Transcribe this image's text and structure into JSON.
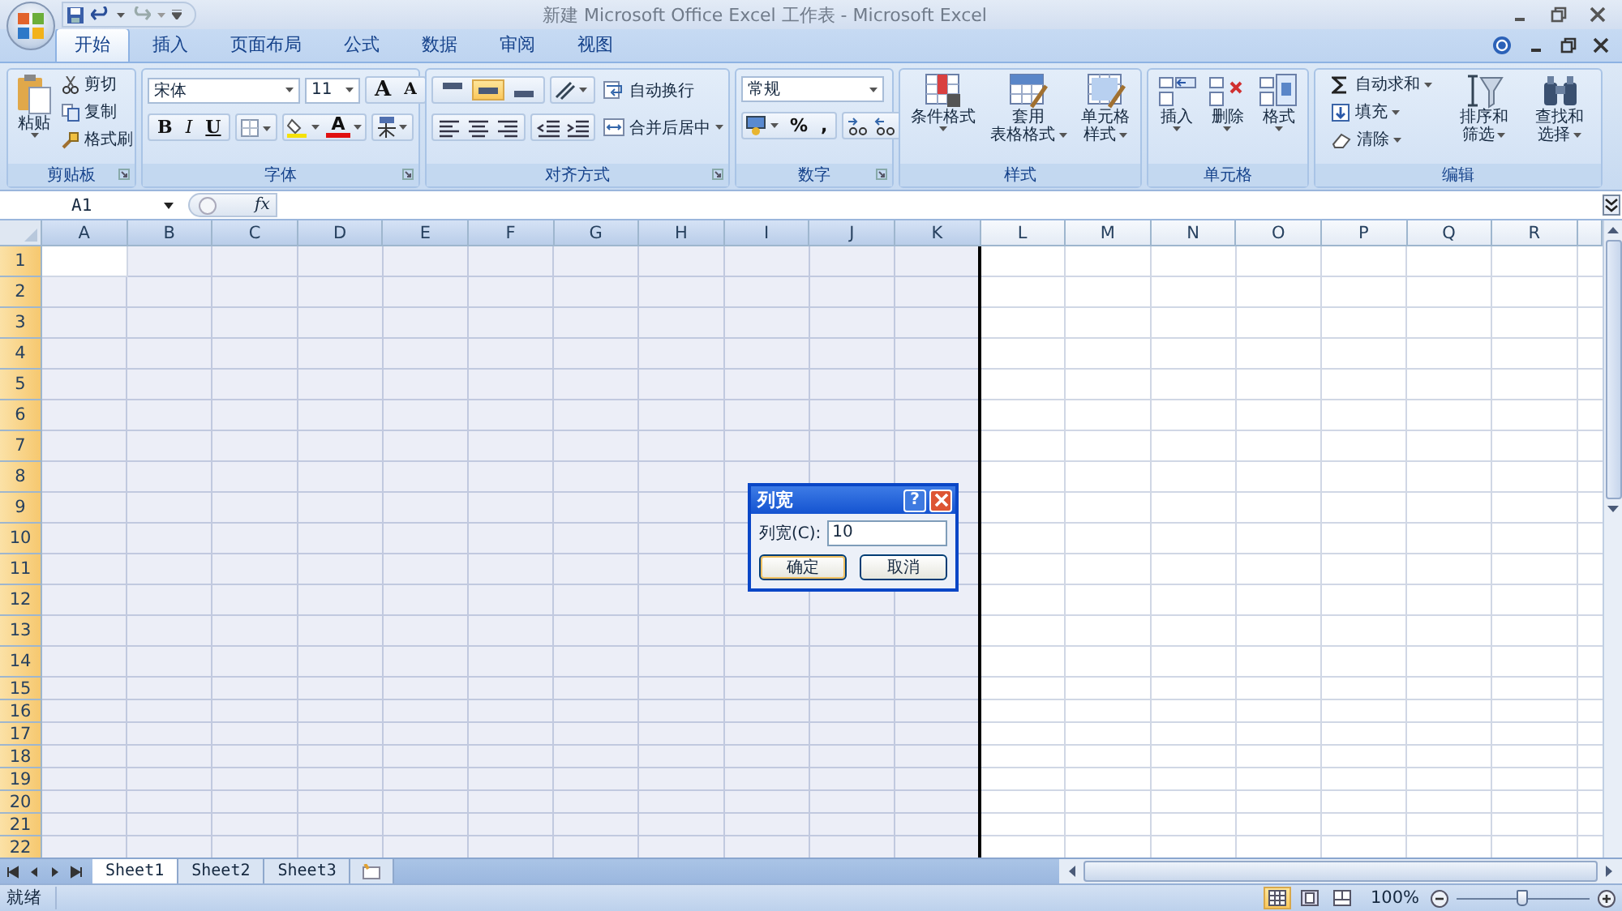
{
  "title_bar": {
    "title": "新建 Microsoft Office Excel 工作表 - Microsoft Excel"
  },
  "ribbon_tabs": [
    {
      "label": "开始",
      "selected": true
    },
    {
      "label": "插入",
      "selected": false
    },
    {
      "label": "页面布局",
      "selected": false
    },
    {
      "label": "公式",
      "selected": false
    },
    {
      "label": "数据",
      "selected": false
    },
    {
      "label": "审阅",
      "selected": false
    },
    {
      "label": "视图",
      "selected": false
    }
  ],
  "ribbon_groups": [
    {
      "kind": "clipboard",
      "label": "剪贴板",
      "launcher": true,
      "large": "粘贴",
      "small": [
        "剪切",
        "复制",
        "格式刷"
      ]
    },
    {
      "kind": "font",
      "label": "字体",
      "launcher": true,
      "font_name": "宋体",
      "font_size": "11",
      "grow": "A",
      "shrink": "A",
      "bold": "B",
      "italic": "I",
      "underline": "U",
      "font_color": "A"
    },
    {
      "kind": "alignment",
      "label": "对齐方式",
      "launcher": true,
      "vertical": [
        {
          "selected": false
        },
        {
          "selected": true
        },
        {
          "selected": false
        }
      ],
      "wrap": "自动换行",
      "merge": "合并后居中"
    },
    {
      "kind": "number",
      "label": "数字",
      "launcher": true,
      "format": "常规",
      "percent": "%",
      "comma": ","
    },
    {
      "kind": "styles",
      "label": "样式",
      "launcher": false,
      "buttons": [
        {
          "lines": [
            "条件格式"
          ]
        },
        {
          "lines": [
            "套用",
            "表格格式"
          ]
        },
        {
          "lines": [
            "单元格",
            "样式"
          ]
        }
      ]
    },
    {
      "kind": "cells",
      "label": "单元格",
      "launcher": false,
      "buttons": [
        {
          "lines": [
            "插入"
          ]
        },
        {
          "lines": [
            "删除"
          ]
        },
        {
          "lines": [
            "格式"
          ]
        }
      ]
    },
    {
      "kind": "editing",
      "label": "编辑",
      "launcher": false,
      "small": [
        "自动求和",
        "填充",
        "清除"
      ],
      "buttons": [
        {
          "lines": [
            "排序和",
            "筛选"
          ]
        },
        {
          "lines": [
            "查找和",
            "选择"
          ]
        }
      ]
    }
  ],
  "formula_bar": {
    "name_box": "A1",
    "function_label": "fx"
  },
  "sheet": {
    "columns": [
      {
        "label": "A",
        "selected": true
      },
      {
        "label": "B",
        "selected": true
      },
      {
        "label": "C",
        "selected": true
      },
      {
        "label": "D",
        "selected": true
      },
      {
        "label": "E",
        "selected": true
      },
      {
        "label": "F",
        "selected": true
      },
      {
        "label": "G",
        "selected": true
      },
      {
        "label": "H",
        "selected": true
      },
      {
        "label": "I",
        "selected": true
      },
      {
        "label": "J",
        "selected": true
      },
      {
        "label": "K",
        "selected": true
      },
      {
        "label": "L",
        "selected": false
      },
      {
        "label": "M",
        "selected": false
      },
      {
        "label": "N",
        "selected": false
      },
      {
        "label": "O",
        "selected": false
      },
      {
        "label": "P",
        "selected": false
      },
      {
        "label": "Q",
        "selected": false
      },
      {
        "label": "R",
        "selected": false
      }
    ],
    "rows": [
      {
        "label": "1",
        "selected": true
      },
      {
        "label": "2",
        "selected": true
      },
      {
        "label": "3",
        "selected": true
      },
      {
        "label": "4",
        "selected": true
      },
      {
        "label": "5",
        "selected": true
      },
      {
        "label": "6",
        "selected": true
      },
      {
        "label": "7",
        "selected": true
      },
      {
        "label": "8",
        "selected": true
      },
      {
        "label": "9",
        "selected": true
      },
      {
        "label": "10",
        "selected": true
      },
      {
        "label": "11",
        "selected": true
      },
      {
        "label": "12",
        "selected": true
      },
      {
        "label": "13",
        "selected": true
      },
      {
        "label": "14",
        "selected": true
      },
      {
        "label": "15",
        "selected": true
      },
      {
        "label": "16",
        "selected": true
      },
      {
        "label": "17",
        "selected": true
      },
      {
        "label": "18",
        "selected": true
      },
      {
        "label": "19",
        "selected": true
      },
      {
        "label": "20",
        "selected": true
      },
      {
        "label": "21",
        "selected": true
      },
      {
        "label": "22",
        "selected": true
      }
    ]
  },
  "sheet_tabs": [
    {
      "label": "Sheet1",
      "selected": true
    },
    {
      "label": "Sheet2",
      "selected": false
    },
    {
      "label": "Sheet3",
      "selected": false
    }
  ],
  "status_bar": {
    "status": "就绪",
    "views": [
      {
        "selected": true
      },
      {
        "selected": false
      },
      {
        "selected": false
      }
    ],
    "zoom": "100%",
    "zoom_slider": {
      "level": 0.5
    }
  },
  "dialog": {
    "title": "列宽",
    "help": "?",
    "field_label": "列宽(C):",
    "value": "10",
    "buttons": [
      {
        "label": "确定",
        "selected": true
      },
      {
        "label": "取消",
        "selected": false
      }
    ]
  }
}
